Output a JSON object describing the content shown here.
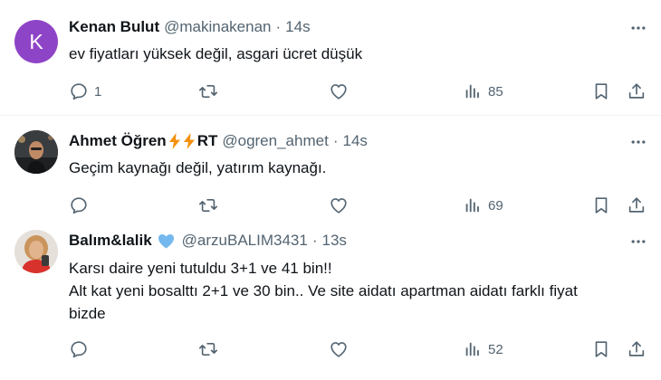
{
  "tweets": [
    {
      "author_name": "Kenan Bulut",
      "handle": "@makinakenan",
      "time": "14s",
      "avatar_letter": "K",
      "text": "ev fiyatları yüksek değil, asgari ücret düşük",
      "reply_count": "1",
      "views": "85"
    },
    {
      "author_name": "Ahmet Öğren",
      "name_suffix": "RT",
      "handle": "@ogren_ahmet",
      "time": "14s",
      "text": "Geçim kaynağı değil, yatırım kaynağı.",
      "views": "69"
    },
    {
      "author_name": "Balım&lalik",
      "handle": "@arzuBALIM3431",
      "time": "13s",
      "text": "Karsı daire yeni tutuldu 3+1 ve 41  bin!!\nAlt kat yeni bosalttı 2+1 ve 30 bin.. Ve site aidatı apartman aidatı farklı fiyat\nbizde",
      "views": "52"
    }
  ],
  "colors": {
    "icon_gray": "#536471",
    "bolt_orange": "#f4900c",
    "heart_blue": "#74b8ee",
    "avatar_purple": "#8e44c6"
  }
}
